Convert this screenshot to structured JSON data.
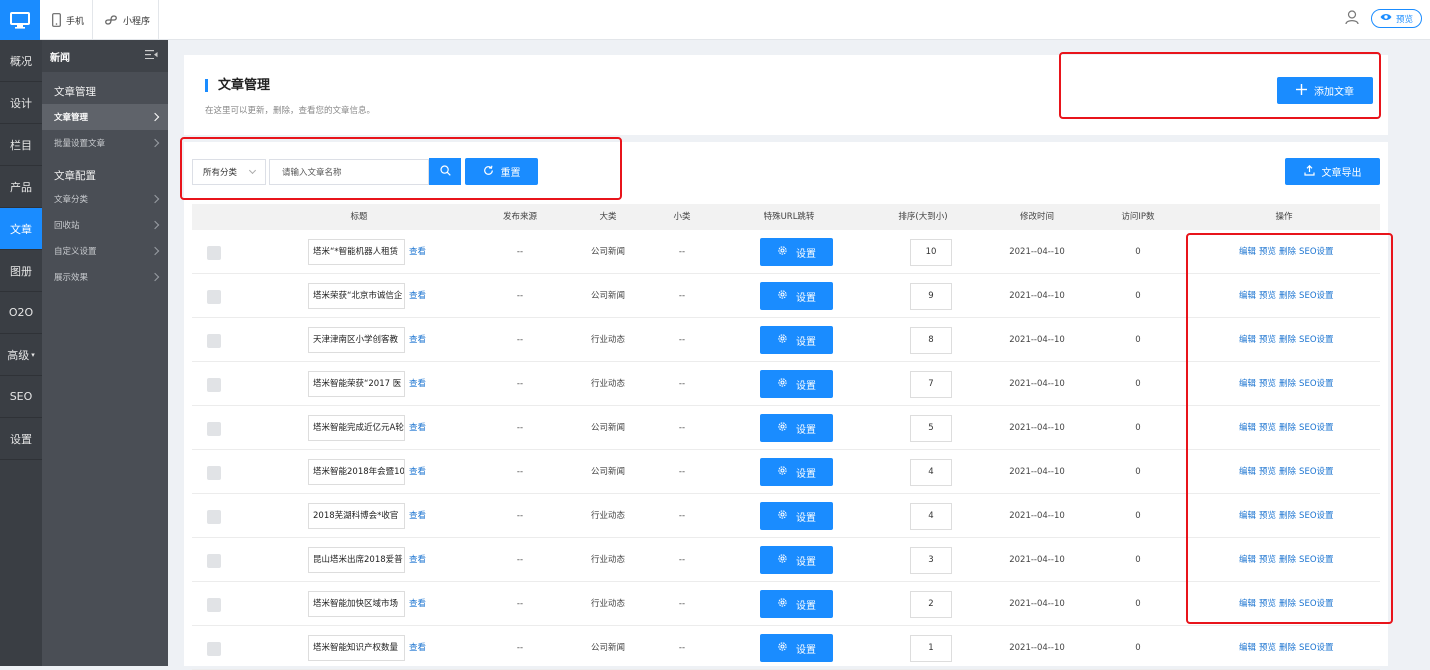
{
  "topbar": {
    "tabs": [
      {
        "label": "手机",
        "icon": "phone-icon"
      },
      {
        "label": "小程序",
        "icon": "miniprogram-icon"
      }
    ],
    "preview_label": "预览"
  },
  "nav_primary": [
    "概况",
    "设计",
    "栏目",
    "产品",
    "文章",
    "图册",
    "O2O",
    "高级",
    "SEO",
    "设置"
  ],
  "nav_primary_active": "文章",
  "nav_secondary": {
    "title": "新闻",
    "groups": [
      {
        "label": "文章管理",
        "items": [
          {
            "label": "文章管理",
            "active": true
          },
          {
            "label": "批量设置文章",
            "active": false
          }
        ]
      },
      {
        "label": "文章配置",
        "items": [
          {
            "label": "文章分类"
          },
          {
            "label": "回收站"
          },
          {
            "label": "自定义设置"
          },
          {
            "label": "展示效果"
          }
        ]
      }
    ]
  },
  "header": {
    "title": "文章管理",
    "subtitle": "在这里可以更新，删除，查看您的文章信息。",
    "add_button": "添加文章"
  },
  "filters": {
    "category_select": "所有分类",
    "search_placeholder": "请输入文章名称",
    "reset_button": "重置",
    "export_button": "文章导出"
  },
  "table": {
    "columns": [
      "标题",
      "发布来源",
      "大类",
      "小类",
      "特殊URL跳转",
      "排序(大到小)",
      "修改时间",
      "访问IP数",
      "操作"
    ],
    "view_label": "查看",
    "set_label": "设置",
    "actions": [
      "编辑",
      "预览",
      "删除",
      "SEO设置"
    ],
    "rows": [
      {
        "title": "塔米“*智能机器人租赁",
        "source": "--",
        "category": "公司新闻",
        "subcategory": "--",
        "order": "10",
        "modified": "2021--04--10",
        "ip": "0"
      },
      {
        "title": "塔米荣获“北京市诚信企",
        "source": "--",
        "category": "公司新闻",
        "subcategory": "--",
        "order": "9",
        "modified": "2021--04--10",
        "ip": "0"
      },
      {
        "title": "天津津南区小学创客教",
        "source": "--",
        "category": "行业动态",
        "subcategory": "--",
        "order": "8",
        "modified": "2021--04--10",
        "ip": "0"
      },
      {
        "title": "塔米智能荣获“2017 医",
        "source": "--",
        "category": "行业动态",
        "subcategory": "--",
        "order": "7",
        "modified": "2021--04--10",
        "ip": "0"
      },
      {
        "title": "塔米智能完成近亿元A轮",
        "source": "--",
        "category": "公司新闻",
        "subcategory": "--",
        "order": "5",
        "modified": "2021--04--10",
        "ip": "0"
      },
      {
        "title": "塔米智能2018年会暨10",
        "source": "--",
        "category": "公司新闻",
        "subcategory": "--",
        "order": "4",
        "modified": "2021--04--10",
        "ip": "0"
      },
      {
        "title": "2018芜湖科博会*收官",
        "source": "--",
        "category": "行业动态",
        "subcategory": "--",
        "order": "4",
        "modified": "2021--04--10",
        "ip": "0"
      },
      {
        "title": "昆山塔米出席2018爱普",
        "source": "--",
        "category": "行业动态",
        "subcategory": "--",
        "order": "3",
        "modified": "2021--04--10",
        "ip": "0"
      },
      {
        "title": "塔米智能加快区域市场",
        "source": "--",
        "category": "行业动态",
        "subcategory": "--",
        "order": "2",
        "modified": "2021--04--10",
        "ip": "0"
      },
      {
        "title": "塔米智能知识产权数量",
        "source": "--",
        "category": "公司新闻",
        "subcategory": "--",
        "order": "1",
        "modified": "2021--04--10",
        "ip": "0"
      }
    ]
  },
  "colors": {
    "accent": "#1a8cff",
    "highlight_box": "#e8141b",
    "sidebar_dark": "#3a3e44",
    "sidebar_mid": "#4a4e55"
  }
}
